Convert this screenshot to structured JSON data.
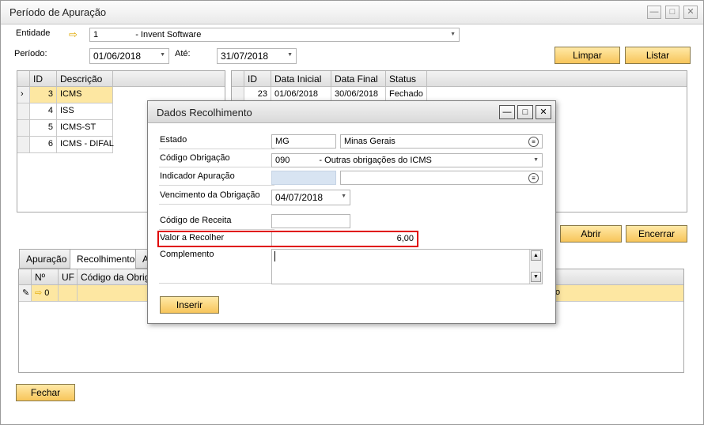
{
  "window": {
    "title": "Período de Apuração",
    "minimize": "—",
    "maximize": "□",
    "close": "✕"
  },
  "filters": {
    "entidade_label": "Entidade",
    "entidade_code": "1",
    "entidade_name": "- Invent Software",
    "periodo_label": "Período:",
    "periodo_value": "01/06/2018",
    "ate_label": "Até:",
    "ate_value": "31/07/2018"
  },
  "buttons": {
    "limpar": "Limpar",
    "listar": "Listar",
    "abrir": "Abrir",
    "encerrar": "Encerrar",
    "fechar": "Fechar"
  },
  "left_grid": {
    "headers": [
      "ID",
      "Descrição"
    ],
    "rows": [
      {
        "id": "3",
        "desc": "ICMS"
      },
      {
        "id": "4",
        "desc": "ISS"
      },
      {
        "id": "5",
        "desc": "ICMS-ST"
      },
      {
        "id": "6",
        "desc": "ICMS - DIFAL"
      }
    ]
  },
  "right_grid": {
    "headers": [
      "ID",
      "Data Inicial",
      "Data Final",
      "Status"
    ],
    "rows": [
      {
        "id": "23",
        "inicio": "01/06/2018",
        "fim": "30/06/2018",
        "status": "Fechado"
      }
    ]
  },
  "tabs": [
    "Apuração",
    "Recolhimento",
    "A"
  ],
  "bottom_grid": {
    "headers": [
      "Nº",
      "UF",
      "Código da Obrigaç"
    ],
    "row_num": "0",
    "partial_text": "o"
  },
  "dialog": {
    "title": "Dados Recolhimento",
    "estado_label": "Estado",
    "estado_code": "MG",
    "estado_name": "Minas Gerais",
    "codigo_label": "Código Obrigação",
    "codigo_value": "090",
    "codigo_desc": "- Outras obrigações do ICMS",
    "indicador_label": "Indicador Apuração",
    "vencimento_label": "Vencimento da Obrigação",
    "vencimento_value": "04/07/2018",
    "receita_label": "Código de Receita",
    "valor_label": "Valor a Recolher",
    "valor_value": "6,00",
    "complemento_label": "Complemento",
    "inserir": "Inserir"
  },
  "colors": {
    "accent_yellow": "#f7c55a",
    "highlight_row": "#fde7a2",
    "valor_box": "#e00000"
  }
}
